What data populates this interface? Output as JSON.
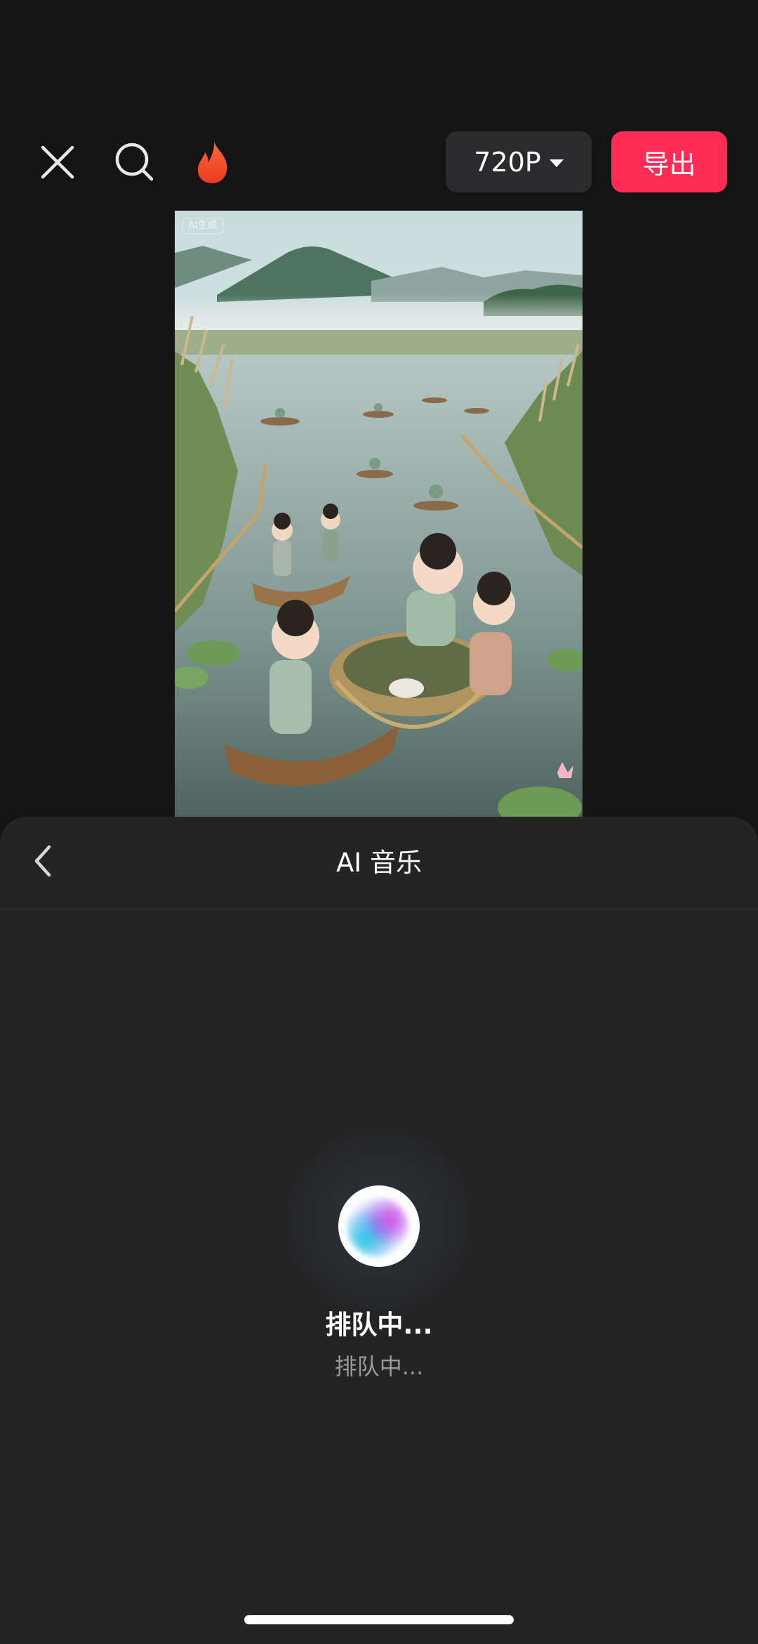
{
  "toolbar": {
    "close_icon": "close-icon",
    "search_icon": "search-icon",
    "hot_icon": "flame-icon",
    "resolution_label": "720P",
    "export_label": "导出",
    "accent_color": "#fe2c55"
  },
  "preview": {
    "ai_tag": "AI生成"
  },
  "sheet": {
    "back_icon": "chevron-left-icon",
    "title": "AI 音乐"
  },
  "status": {
    "title": "排队中...",
    "subtitle": "排队中..."
  }
}
